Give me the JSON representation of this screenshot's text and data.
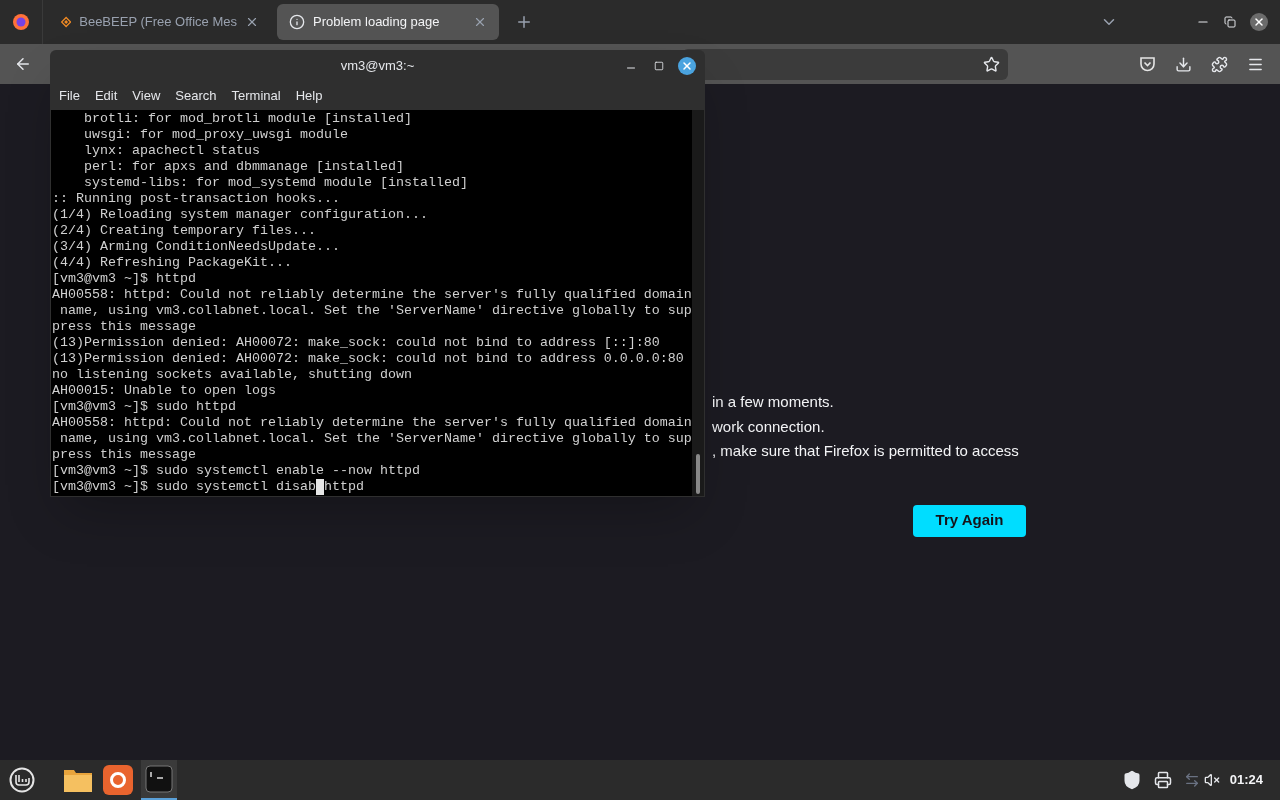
{
  "browser": {
    "tabs": [
      {
        "title": "BeeBEEP (Free Office Mes",
        "selected": false,
        "kind": "app"
      },
      {
        "title": "Problem loading page",
        "selected": true,
        "kind": "info"
      }
    ],
    "page": {
      "lines": [
        "in a few moments.",
        "work connection.",
        ", make sure that Firefox is permitted to access"
      ],
      "button": "Try Again"
    }
  },
  "terminal": {
    "title": "vm3@vm3:~",
    "menu": [
      "File",
      "Edit",
      "View",
      "Search",
      "Terminal",
      "Help"
    ],
    "lines": [
      "    brotli: for mod_brotli module [installed]",
      "    uwsgi: for mod_proxy_uwsgi module",
      "    lynx: apachectl status",
      "    perl: for apxs and dbmmanage [installed]",
      "    systemd-libs: for mod_systemd module [installed]",
      ":: Running post-transaction hooks...",
      "(1/4) Reloading system manager configuration...",
      "(2/4) Creating temporary files...",
      "(3/4) Arming ConditionNeedsUpdate...",
      "(4/4) Refreshing PackageKit...",
      "[vm3@vm3 ~]$ httpd",
      "AH00558: httpd: Could not reliably determine the server's fully qualified domain",
      " name, using vm3.collabnet.local. Set the 'ServerName' directive globally to sup",
      "press this message",
      "(13)Permission denied: AH00072: make_sock: could not bind to address [::]:80",
      "(13)Permission denied: AH00072: make_sock: could not bind to address 0.0.0.0:80",
      "no listening sockets available, shutting down",
      "AH00015: Unable to open logs",
      "[vm3@vm3 ~]$ sudo httpd",
      "AH00558: httpd: Could not reliably determine the server's fully qualified domain",
      " name, using vm3.collabnet.local. Set the 'ServerName' directive globally to sup",
      "press this message",
      "[vm3@vm3 ~]$ sudo systemctl enable --now httpd"
    ],
    "input": {
      "before_cursor": "[vm3@vm3 ~]$ sudo systemctl disab",
      "after_cursor": "httpd"
    }
  },
  "taskbar": {
    "clock": "01:24"
  }
}
